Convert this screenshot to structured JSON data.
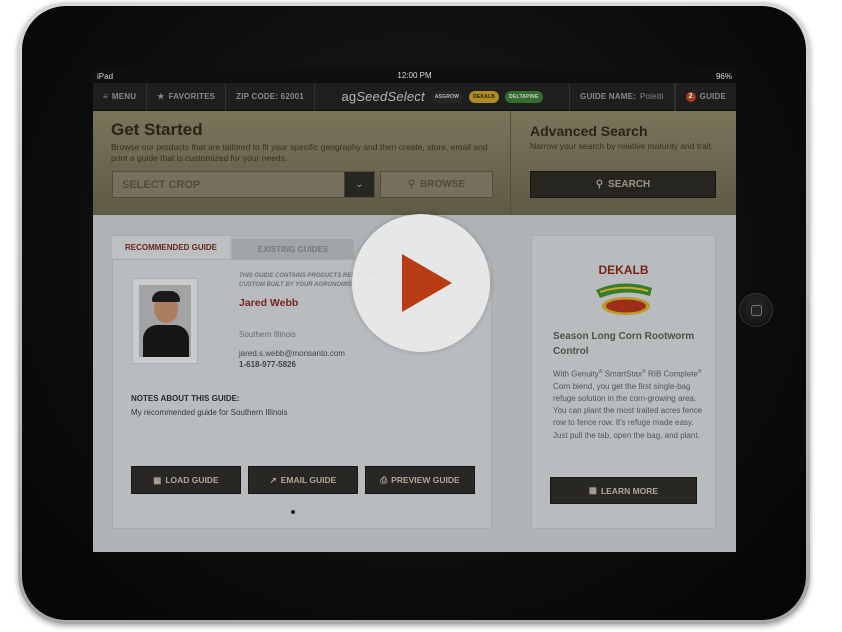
{
  "status_bar": {
    "device": "iPad",
    "time": "12:00 PM",
    "battery": "96%"
  },
  "nav": {
    "menu": "MENU",
    "favorites": "FAVORITES",
    "zip_label": "ZIP CODE: 62001",
    "brand_prefix": "ag",
    "brand_name": "SeedSelect",
    "partner_logos": [
      "ASGROW",
      "DEKALB",
      "DELTAPINE"
    ],
    "guide_name_label": "GUIDE NAME:",
    "guide_name_value": "Poletti",
    "guide_count": "2",
    "guide_label": "GUIDE"
  },
  "get_started": {
    "title": "Get Started",
    "description": "Browse our products that are tailored to fit your specific geography and then create, store, email and print a guide that is customized for your needs.",
    "select_placeholder": "SELECT CROP",
    "browse_label": "BROWSE"
  },
  "advanced_search": {
    "title": "Advanced Search",
    "description": "Narrow your search by relative maturity and trait.",
    "search_label": "SEARCH"
  },
  "tabs": [
    {
      "label": "RECOMMENDED GUIDE"
    },
    {
      "label": "EXISTING GUIDES"
    }
  ],
  "guide": {
    "intro": "THIS GUIDE CONTAINS PRODUCTS RECOMMENDED FOR YOUR AREA AND WAS CUSTOM BUILT BY YOUR AGRONOMIST.",
    "name": "Jared Webb",
    "region": "Southern Illinois",
    "email": "jared.s.webb@monsanto.com",
    "phone": "1-618-977-5826",
    "notes_heading": "NOTES ABOUT THIS GUIDE:",
    "notes_text": "My recommended guide for Southern Illinois",
    "load_label": "LOAD GUIDE",
    "email_label": "EMAIL GUIDE",
    "preview_label": "PREVIEW GUIDE"
  },
  "promo": {
    "brand": "DEKALB",
    "heading": "Season Long Corn Rootworm Control",
    "body_1": "With Genuity",
    "body_2": " SmartStax",
    "body_3": " RIB Complete",
    "body_4": " Corn blend, you get the first single-bag refuge solution in the corn-growing area. You can plant the most traited acres fence row to fence row. It's refuge made easy. Just pull the tab, open the bag, and plant.",
    "learn_more": "LEARN MORE"
  },
  "colors": {
    "accent_red": "#8a2a1b",
    "play_orange": "#b73c14",
    "hero_khaki": "#8d8568"
  }
}
